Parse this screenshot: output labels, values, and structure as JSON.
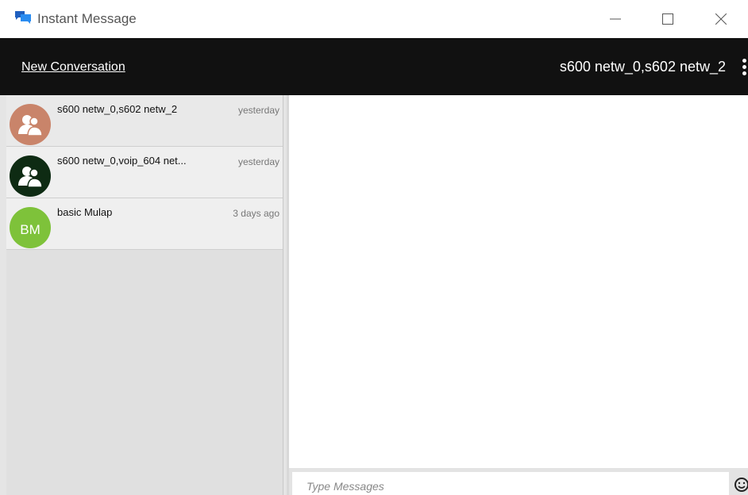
{
  "window": {
    "title": "Instant Message",
    "controls": [
      "minimize-icon",
      "maximize-icon",
      "close-icon"
    ]
  },
  "header": {
    "new_conversation_label": "New Conversation",
    "active_conversation": "s600 netw_0,s602 netw_2"
  },
  "conversations": [
    {
      "name": "s600 netw_0,s602 netw_2",
      "time": "yesterday",
      "avatar": "group-icon",
      "avatar_color": "#c9846a",
      "selected": true
    },
    {
      "name": "s600 netw_0,voip_604 net...",
      "time": "yesterday",
      "avatar": "group-icon",
      "avatar_color": "#0e2b13",
      "selected": false
    },
    {
      "name": "basic Mulap",
      "time": "3 days ago",
      "avatar_initials": "BM",
      "avatar_color": "#7ec23a",
      "selected": false
    }
  ],
  "composer": {
    "placeholder": "Type Messages",
    "value": ""
  },
  "colors": {
    "header_bg": "#111111",
    "app_icon": "#1a73e8"
  }
}
